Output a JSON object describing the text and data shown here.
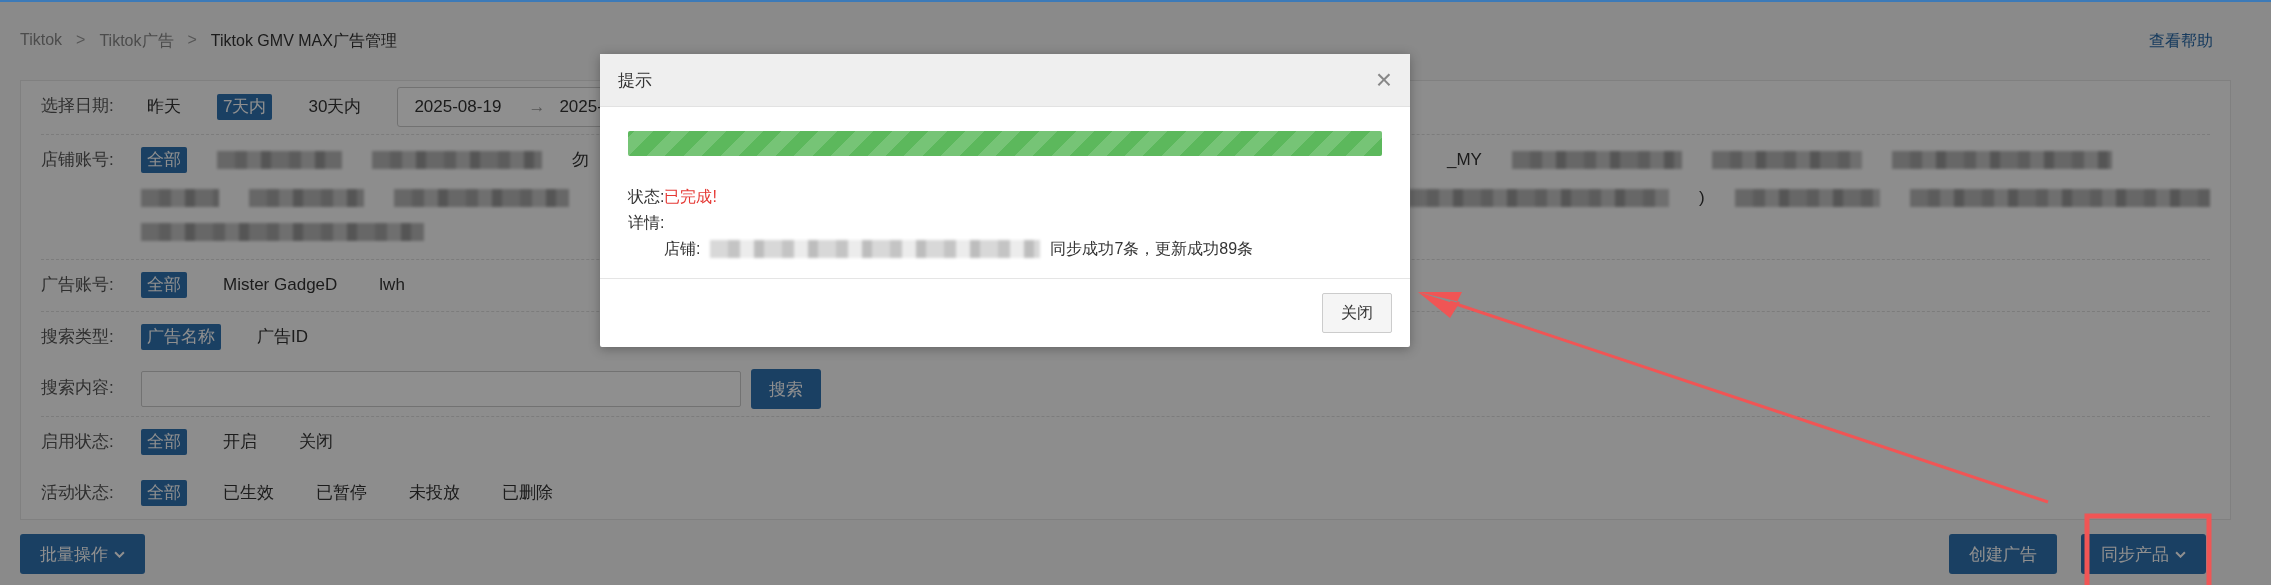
{
  "breadcrumb": {
    "separator": ">",
    "items": [
      "Tiktok",
      "Tiktok广告",
      "Tiktok GMV MAX广告管理"
    ]
  },
  "help_link": "查看帮助",
  "filters": [
    {
      "kind": "date",
      "label": "选择日期:",
      "options": [
        {
          "label": "昨天",
          "selected": false
        },
        {
          "label": "7天内",
          "selected": true
        },
        {
          "label": "30天内",
          "selected": false
        }
      ],
      "start": "2025-08-19",
      "arrow": "→",
      "end": "2025-"
    },
    {
      "kind": "shops",
      "label": "店铺账号:",
      "items": [
        {
          "kind": "option",
          "label": "全部",
          "selected": true
        },
        {
          "kind": "redacted"
        },
        {
          "kind": "redacted"
        },
        {
          "kind": "fragment",
          "label": "勿"
        },
        {
          "kind": "fragment",
          "label": "_MY"
        },
        {
          "kind": "redacted"
        },
        {
          "kind": "redacted"
        },
        {
          "kind": "redacted"
        },
        {
          "kind": "redacted"
        },
        {
          "kind": "redacted"
        },
        {
          "kind": "redacted"
        },
        {
          "kind": "redacted"
        },
        {
          "kind": "fragment",
          "label": ")"
        },
        {
          "kind": "redacted"
        },
        {
          "kind": "redacted"
        },
        {
          "kind": "redacted"
        }
      ]
    },
    {
      "kind": "options",
      "label": "广告账号:",
      "options": [
        {
          "label": "全部",
          "selected": true
        },
        {
          "label": "Mister GadgeD",
          "selected": false
        },
        {
          "label": "lwh",
          "selected": false
        }
      ]
    },
    {
      "kind": "options",
      "label": "搜索类型:",
      "options": [
        {
          "label": "广告名称",
          "selected": true
        },
        {
          "label": "广告ID",
          "selected": false
        }
      ]
    },
    {
      "kind": "search",
      "label": "搜索内容:",
      "button": "搜索"
    },
    {
      "kind": "options",
      "label": "启用状态:",
      "options": [
        {
          "label": "全部",
          "selected": true
        },
        {
          "label": "开启",
          "selected": false
        },
        {
          "label": "关闭",
          "selected": false
        }
      ]
    },
    {
      "kind": "options",
      "label": "活动状态:",
      "options": [
        {
          "label": "全部",
          "selected": true
        },
        {
          "label": "已生效",
          "selected": false
        },
        {
          "label": "已暂停",
          "selected": false
        },
        {
          "label": "未投放",
          "selected": false
        },
        {
          "label": "已删除",
          "selected": false
        }
      ]
    }
  ],
  "actions": {
    "left": [
      {
        "label": "批量操作",
        "dropdown": true
      }
    ],
    "right": [
      {
        "label": "创建广告",
        "dropdown": false
      },
      {
        "label": "同步产品",
        "dropdown": true
      }
    ]
  },
  "dialog": {
    "title": "提示",
    "close": "×",
    "progress": {
      "level": 1
    },
    "status_label": "状态:",
    "status_value": "已完成!",
    "details_label": "详情:",
    "shop_label": "店铺:",
    "result": "同步成功7条，更新成功89条",
    "button": "关闭"
  }
}
